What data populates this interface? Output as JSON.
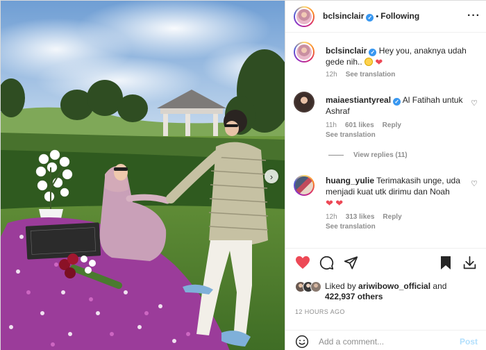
{
  "header": {
    "username": "bclsinclair",
    "separator": "•",
    "follow_status": "Following",
    "more_label": "···"
  },
  "caption": {
    "username": "bclsinclair",
    "text": "Hey you, anaknya udah gede nih..",
    "time": "12h",
    "see_translation": "See translation"
  },
  "comments": [
    {
      "username": "maiaestiantyreal",
      "verified": true,
      "text": "Al Fatihah untuk Ashraf",
      "time": "11h",
      "likes": "601 likes",
      "reply": "Reply",
      "see_translation": "See translation",
      "view_replies": "View replies (11)"
    },
    {
      "username": "huang_yulie",
      "verified": false,
      "text": "Terimakasih unge, uda menjadi kuat utk dirimu dan Noah",
      "time": "12h",
      "likes": "313 likes",
      "reply": "Reply",
      "see_translation": "See translation"
    }
  ],
  "actions": {
    "liked_by_prefix": "Liked by",
    "liked_by_user": "ariwibowo_official",
    "liked_by_and": "and",
    "likes_count": "422,937 others",
    "timestamp": "12 HOURS AGO"
  },
  "add_comment": {
    "placeholder": "Add a comment...",
    "post_label": "Post"
  },
  "photo": {
    "next_label": "›"
  },
  "icons": [
    "heart-icon",
    "comment-icon",
    "share-icon",
    "bookmark-icon",
    "download-icon",
    "smile-icon",
    "verified-icon",
    "more-icon",
    "chevron-right-icon"
  ],
  "colors": {
    "like": "#ed4956",
    "verified": "#3897f0",
    "muted": "#8e8e8e",
    "post_disabled": "#b2dffc"
  }
}
